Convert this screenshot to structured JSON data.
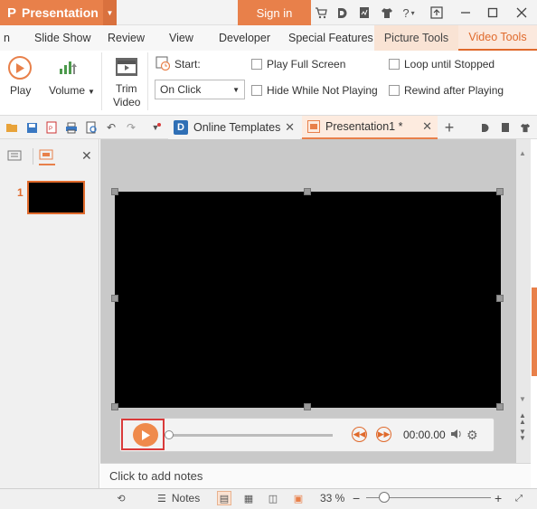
{
  "titlebar": {
    "app_name": "Presentation",
    "app_logo": "P",
    "signin_label": "Sign in",
    "icons": [
      "cart-icon",
      "d-logo-icon",
      "document-icon",
      "shirt-icon",
      "help-icon",
      "restore-icon",
      "minimize-icon",
      "maximize-icon",
      "close-icon"
    ]
  },
  "ribbon_tabs": [
    {
      "label": "n",
      "name": "tab-home-partial"
    },
    {
      "label": "Slide Show",
      "name": "tab-slide-show"
    },
    {
      "label": "Review",
      "name": "tab-review"
    },
    {
      "label": "View",
      "name": "tab-view"
    },
    {
      "label": "Developer",
      "name": "tab-developer"
    },
    {
      "label": "Special Features",
      "name": "tab-special-features"
    },
    {
      "label": "Picture Tools",
      "name": "tab-picture-tools"
    },
    {
      "label": "Video Tools",
      "name": "tab-video-tools"
    }
  ],
  "ribbon": {
    "play_label": "Play",
    "volume_label": "Volume",
    "trim_label_1": "Trim",
    "trim_label_2": "Video",
    "start_label": "Start:",
    "start_value": "On Click",
    "play_full_screen": "Play Full Screen",
    "hide_while_not_playing": "Hide While Not Playing",
    "loop_until_stopped": "Loop until Stopped",
    "rewind_after_playing": "Rewind after Playing"
  },
  "doc_tabs": {
    "online_templates": "Online Templates",
    "presentation": "Presentation1 *"
  },
  "left_panel": {
    "slide_number": "1"
  },
  "player": {
    "time": "00:00.00"
  },
  "notes": {
    "placeholder": "Click to add notes"
  },
  "status": {
    "notes_label": "Notes",
    "zoom": "33 %"
  },
  "colors": {
    "accent": "#e8804a",
    "active_tab_text": "#e06a2c",
    "highlight_frame": "#d93a3a"
  }
}
